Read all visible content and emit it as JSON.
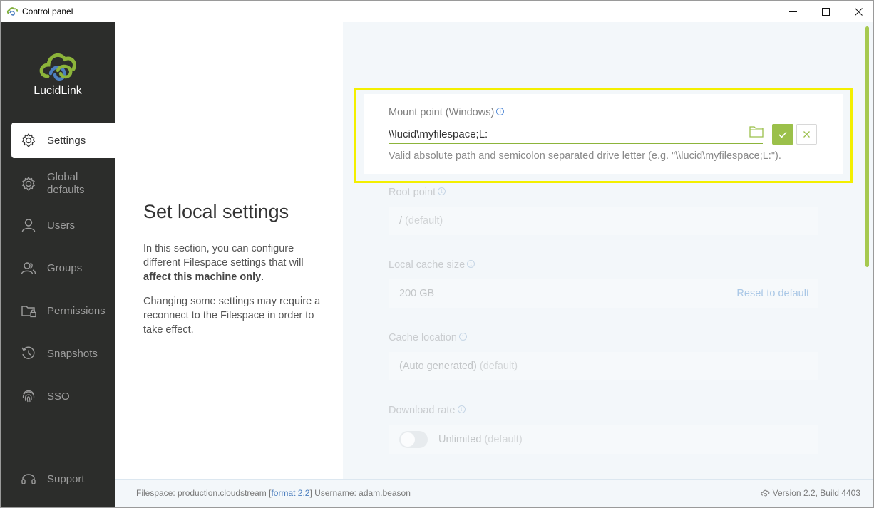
{
  "window": {
    "title": "Control panel",
    "minimize": "—",
    "maximize": "☐",
    "close": "✕"
  },
  "brand": {
    "name": "LucidLink",
    "accent_green": "#9bc04a",
    "accent_blue": "#5a8fd8"
  },
  "sidebar": {
    "items": [
      {
        "label": "Settings",
        "icon": "gear-icon",
        "active": true
      },
      {
        "label": "Global defaults",
        "icon": "global-gear-icon",
        "active": false
      },
      {
        "label": "Users",
        "icon": "user-icon",
        "active": false
      },
      {
        "label": "Groups",
        "icon": "group-icon",
        "active": false
      },
      {
        "label": "Permissions",
        "icon": "folder-lock-icon",
        "active": false
      },
      {
        "label": "Snapshots",
        "icon": "history-icon",
        "active": false
      },
      {
        "label": "SSO",
        "icon": "fingerprint-icon",
        "active": false
      }
    ],
    "support": {
      "label": "Support",
      "icon": "headset-icon"
    }
  },
  "intro": {
    "title": "Set local settings",
    "p1_a": "In this section, you can configure different Filespace settings that will ",
    "p1_bold": "affect this machine only",
    "p1_b": ".",
    "p2": "Changing some settings may require a reconnect to the Filespace in order to take effect."
  },
  "mount_point": {
    "label": "Mount point (Windows)",
    "value": "\\\\lucid\\myfilespace;L:",
    "hint": "Valid absolute path and semicolon separated drive letter (e.g. \"\\\\lucid\\myfilespace;L:\")."
  },
  "settings": {
    "root_point": {
      "label": "Root point",
      "value": "/",
      "suffix": "(default)"
    },
    "cache_size": {
      "label": "Local cache size",
      "value": "200 GB",
      "action": "Reset to default"
    },
    "cache_location": {
      "label": "Cache location",
      "value": "(Auto generated)",
      "suffix": "(default)"
    },
    "download_rate": {
      "label": "Download rate",
      "value": "Unlimited",
      "suffix": "(default)",
      "enabled": false
    }
  },
  "footer": {
    "filespace_prefix": "Filespace: production.cloudstream [",
    "format_link": "format 2.2",
    "filespace_suffix": "] Username: adam.beason",
    "version": "Version 2.2, Build 4403"
  }
}
